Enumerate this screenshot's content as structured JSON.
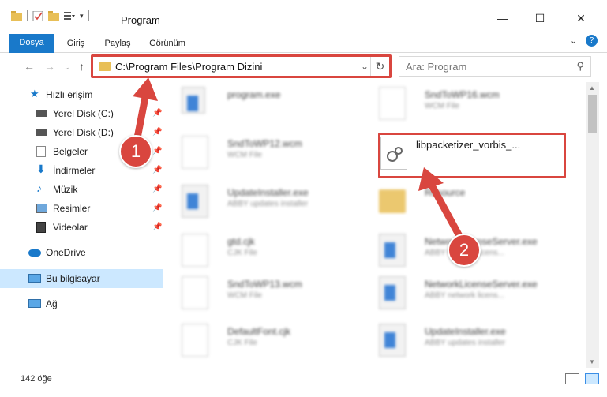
{
  "window": {
    "title": "Program"
  },
  "ribbon": {
    "tabs": [
      "Dosya",
      "Giriş",
      "Paylaş",
      "Görünüm"
    ]
  },
  "nav": {
    "address_path": "C:\\Program Files\\Program Dizini",
    "search_placeholder": "Ara: Program"
  },
  "sidebar": {
    "items": [
      {
        "label": "Hızlı erişim",
        "icon": "star-icon"
      },
      {
        "label": "Yerel Disk (C:)",
        "icon": "drive-icon"
      },
      {
        "label": "Yerel Disk (D:)",
        "icon": "drive-icon"
      },
      {
        "label": "Belgeler",
        "icon": "documents-icon"
      },
      {
        "label": "İndirmeler",
        "icon": "download-icon"
      },
      {
        "label": "Müzik",
        "icon": "music-icon"
      },
      {
        "label": "Resimler",
        "icon": "pictures-icon"
      },
      {
        "label": "Videolar",
        "icon": "video-icon"
      },
      {
        "label": "OneDrive",
        "icon": "cloud-icon"
      },
      {
        "label": "Bu bilgisayar",
        "icon": "computer-icon"
      },
      {
        "label": "Ağ",
        "icon": "network-icon"
      }
    ]
  },
  "files": [
    {
      "name": "program.exe",
      "sub": "",
      "icon": "exe"
    },
    {
      "name": "SndToWP16.wcm",
      "sub": "WCM File",
      "icon": "doc"
    },
    {
      "name": "SndToWP12.wcm",
      "sub": "WCM File",
      "icon": "doc"
    },
    {
      "name": "libpacketizer_vorbis_...",
      "sub": "",
      "icon": "gear"
    },
    {
      "name": "UpdateInstaller.exe",
      "sub": "ABBY updates installer",
      "icon": "exe"
    },
    {
      "name": "Resource",
      "sub": "",
      "icon": "folder"
    },
    {
      "name": "gtd.cjk",
      "sub": "CJK File",
      "icon": "doc"
    },
    {
      "name": "NetworkLicenseServer.exe",
      "sub": "ABBY network licens...",
      "icon": "exe"
    },
    {
      "name": "SndToWP13.wcm",
      "sub": "WCM File",
      "icon": "doc"
    },
    {
      "name": "NetworkLicenseServer.exe",
      "sub": "ABBY network licens...",
      "icon": "exe"
    },
    {
      "name": "DefaultFont.cjk",
      "sub": "CJK File",
      "icon": "doc"
    },
    {
      "name": "UpdateInstaller.exe",
      "sub": "ABBY updates installer",
      "icon": "exe"
    }
  ],
  "status": {
    "count": "142 öğe"
  },
  "callouts": {
    "one": "1",
    "two": "2"
  },
  "colors": {
    "accent": "#1979ca",
    "highlight": "#d9463f",
    "selected": "#cce8ff"
  }
}
